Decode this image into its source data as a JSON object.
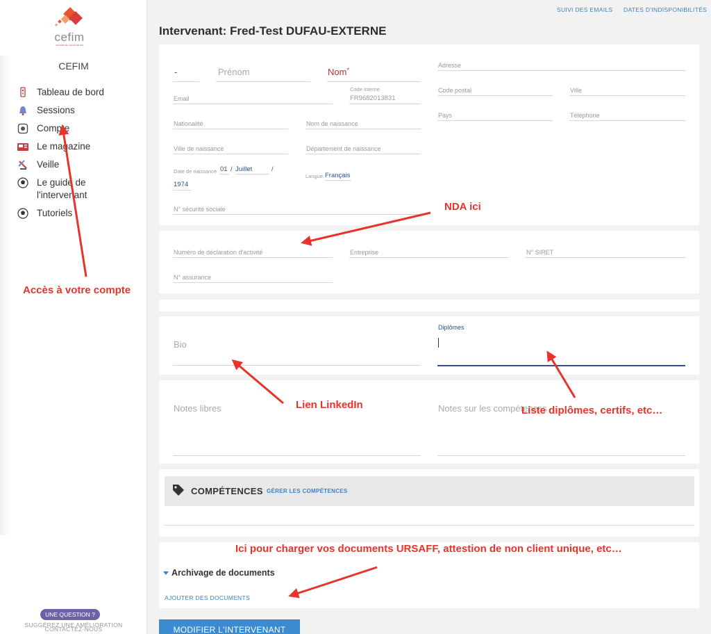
{
  "sidebar": {
    "logo_text": "cefim",
    "logo_sub": "CENTRE DE L'AFOR DE ROI",
    "brand": "CEFIM",
    "items": [
      {
        "label": "Tableau de bord",
        "icon": "dashboard-icon"
      },
      {
        "label": "Sessions",
        "icon": "bell-icon"
      },
      {
        "label": "Compte",
        "icon": "account-icon"
      },
      {
        "label": "Le magazine",
        "icon": "magazine-icon"
      },
      {
        "label": "Veille",
        "icon": "satellite-icon"
      },
      {
        "label": "Le guide de l'intervenant",
        "icon": "ball-icon"
      },
      {
        "label": "Tutoriels",
        "icon": "ball-icon"
      }
    ],
    "help_button": "UNE QUESTION ?",
    "help_line1": "SUGGÉREZ UNE AMÉLIORATION",
    "help_line2": "CONTACTEZ-NOUS"
  },
  "header": {
    "link_emails": "SUIVI DES EMAILS",
    "link_dates": "DATES D'INDISPONIBILITÉS",
    "title": "Intervenant: Fred-Test DUFAU-EXTERNE"
  },
  "identity": {
    "civility": "-",
    "firstname_placeholder": "Prénom",
    "lastname_label": "Nom",
    "required_mark": "*",
    "email_label": "Email",
    "internal_code_label": "Code interne",
    "internal_code_value": "FR9682013831",
    "nationality_label": "Nationalité",
    "birth_name_label": "Nom de naissance",
    "birth_city_label": "Ville de naissance",
    "birth_dept_label": "Département de naissance",
    "birth_date_label": "Date de naissance",
    "birth_day": "01",
    "birth_sep": "/",
    "birth_month": "Juillet",
    "birth_year": "1974",
    "language_label": "Langue:",
    "language_value": "Français",
    "ssn_label": "N° sécurité sociale",
    "address_label": "Adresse",
    "postal_label": "Code postal",
    "city_label": "Ville",
    "country_label": "Pays",
    "phone_label": "Téléphone"
  },
  "business": {
    "nda_label": "Numéro de déclaration d'activité",
    "company_label": "Entreprise",
    "siret_label": "N° SIRET",
    "insurance_label": "N° assurance"
  },
  "texts": {
    "bio_placeholder": "Bio",
    "diplomas_label": "Diplômes",
    "notes_placeholder": "Notes libres",
    "skills_notes_placeholder": "Notes sur les compétences"
  },
  "skills": {
    "title": "COMPÉTENCES",
    "manage_link": "GÉRER LES COMPÉTENCES"
  },
  "archive": {
    "title": "Archivage de documents",
    "add_link": "AJOUTER DES DOCUMENTS"
  },
  "submit_label": "MODIFIER L'INTERVENANT",
  "annotations": {
    "nda": "NDA ici",
    "account": "Accès à votre compte",
    "linkedin": "Lien LinkedIn",
    "diplomas": "Liste diplômes, certifs, etc…",
    "documents": "Ici pour charger vos documents URSAFF, attestion de non client unique, etc…"
  },
  "colors": {
    "link": "#3f7fbf",
    "annotation": "#e8332a",
    "required": "#c03030",
    "button": "#3a8bd0",
    "help_pill": "#6b62a8"
  }
}
